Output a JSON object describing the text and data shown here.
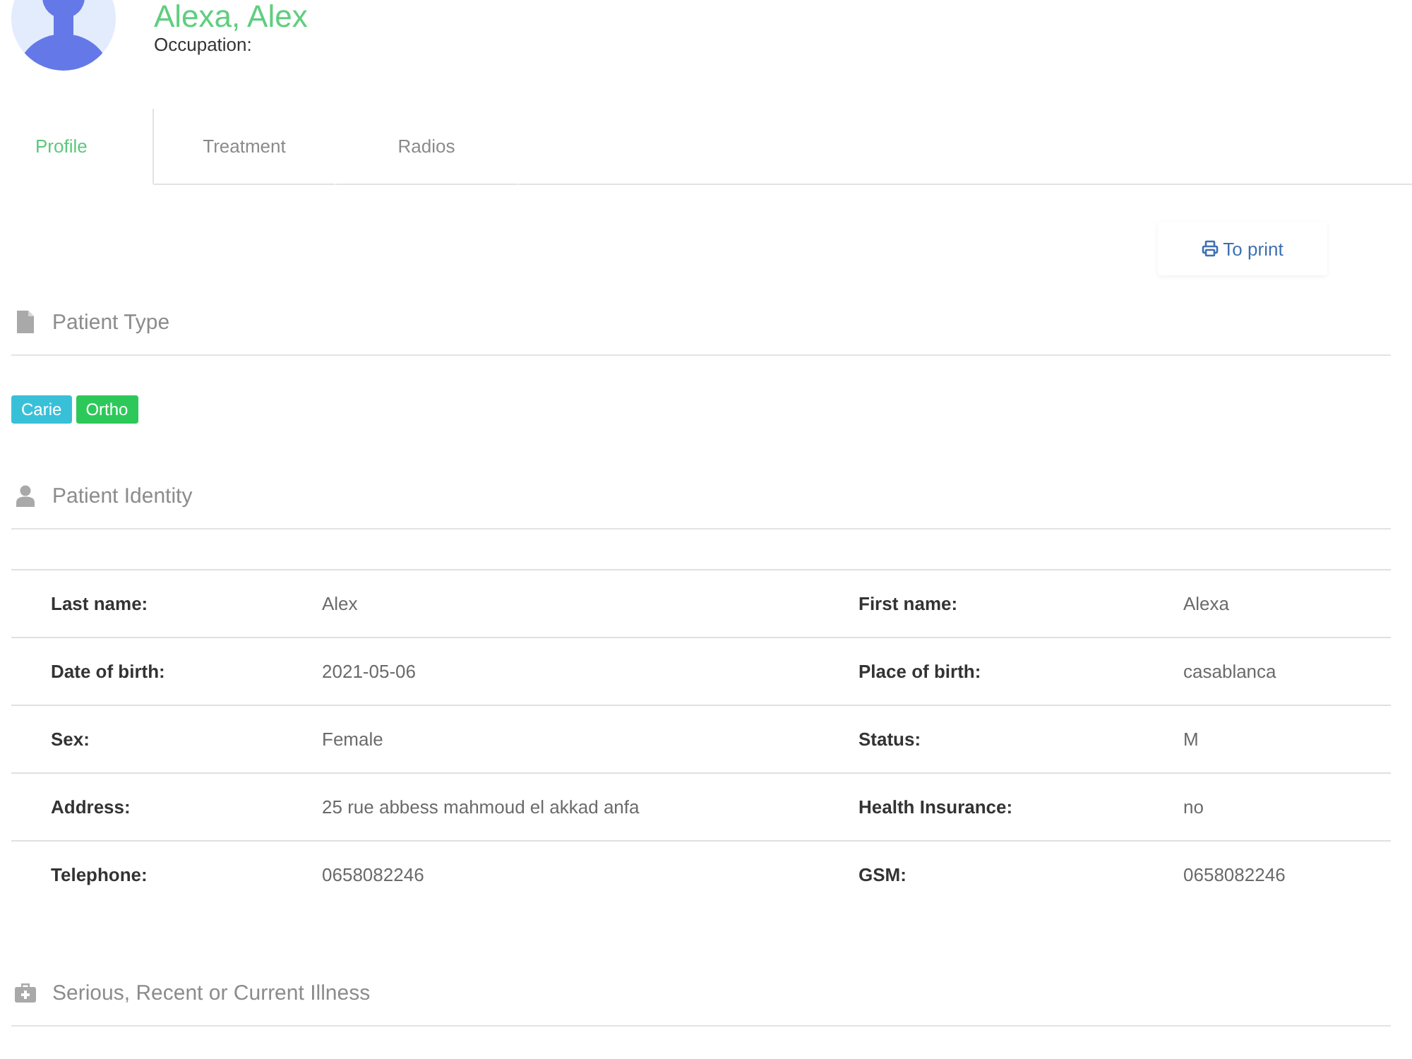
{
  "header": {
    "name": "Alexa, Alex",
    "occupation": "Occupation:"
  },
  "tabs": [
    {
      "label": "Profile",
      "selected": true
    },
    {
      "label": "Treatment",
      "selected": false
    },
    {
      "label": "Radios",
      "selected": false
    }
  ],
  "print_button": {
    "label": "To print"
  },
  "patient_type": {
    "title": "Patient Type",
    "tags": [
      {
        "label": "Carie",
        "color": "#39c0d9"
      },
      {
        "label": "Ortho",
        "color": "#2dc85a"
      }
    ]
  },
  "patient_identity": {
    "title": "Patient Identity",
    "rows": [
      {
        "fields": [
          {
            "label": "Last name:",
            "value": "Alex"
          },
          {
            "label": "First name:",
            "value": "Alexa"
          }
        ]
      },
      {
        "fields": [
          {
            "label": "Date of birth:",
            "value": "2021-05-06"
          },
          {
            "label": "Place of birth:",
            "value": "casablanca"
          }
        ]
      },
      {
        "fields": [
          {
            "label": "Sex:",
            "value": "Female"
          },
          {
            "label": "Status:",
            "value": "M"
          }
        ]
      },
      {
        "fields": [
          {
            "label": "Address:",
            "value": "25 rue abbess mahmoud el akkad anfa"
          },
          {
            "label": "Health Insurance:",
            "value": "no"
          }
        ]
      },
      {
        "fields": [
          {
            "label": "Telephone:",
            "value": "0658082246"
          },
          {
            "label": "GSM:",
            "value": "0658082246"
          }
        ]
      }
    ]
  },
  "illness": {
    "title": "Serious, Recent or Current Illness"
  }
}
